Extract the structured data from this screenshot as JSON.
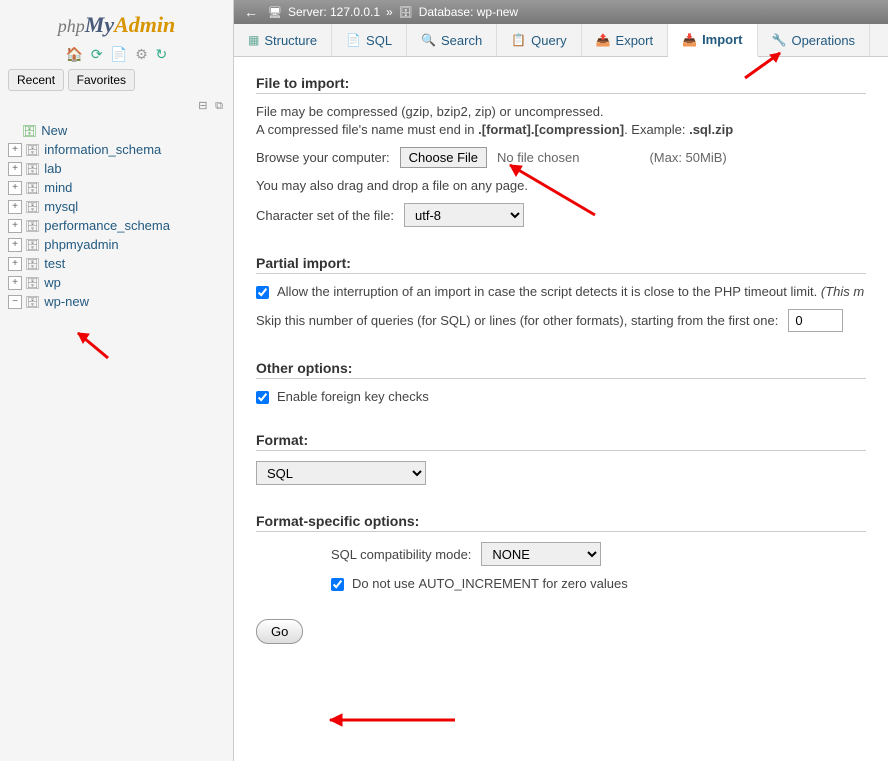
{
  "logo": {
    "php": "php",
    "my": "My",
    "admin": "Admin"
  },
  "sidebar": {
    "recent": "Recent",
    "favorites": "Favorites",
    "newLabel": "New",
    "databases": [
      "information_schema",
      "lab",
      "mind",
      "mysql",
      "performance_schema",
      "phpmyadmin",
      "test",
      "wp",
      "wp-new"
    ]
  },
  "breadcrumb": {
    "serverLabel": "Server:",
    "server": "127.0.0.1",
    "sep": "»",
    "databaseLabel": "Database:",
    "database": "wp-new"
  },
  "tabs": {
    "structure": "Structure",
    "sql": "SQL",
    "search": "Search",
    "query": "Query",
    "export": "Export",
    "import": "Import",
    "operations": "Operations"
  },
  "importForm": {
    "fileToImport": "File to import:",
    "compressHelp": "File may be compressed (gzip, bzip2, zip) or uncompressed.",
    "compressHelp2a": "A compressed file's name must end in ",
    "compressHelp2b": ".[format].[compression]",
    "compressHelp2c": ". Example: ",
    "compressHelp2d": ".sql.zip",
    "browseLabel": "Browse your computer:",
    "chooseFile": "Choose File",
    "noFile": "No file chosen",
    "maxSize": "(Max: 50MiB)",
    "dragHelp": "You may also drag and drop a file on any page.",
    "charsetLabel": "Character set of the file:",
    "charsetValue": "utf-8",
    "partialImport": "Partial import:",
    "allowInterrupt": "Allow the interruption of an import in case the script detects it is close to the PHP timeout limit.",
    "allowInterruptHint": "(This m",
    "skipLabel": "Skip this number of queries (for SQL) or lines (for other formats), starting from the first one:",
    "skipValue": "0",
    "otherOptions": "Other options:",
    "foreignKey": "Enable foreign key checks",
    "format": "Format:",
    "formatValue": "SQL",
    "formatSpecific": "Format-specific options:",
    "compatLabel": "SQL compatibility mode:",
    "compatValue": "NONE",
    "autoInc1": "Do not use ",
    "autoInc2": "AUTO_INCREMENT",
    "autoInc3": " for zero values",
    "go": "Go"
  }
}
